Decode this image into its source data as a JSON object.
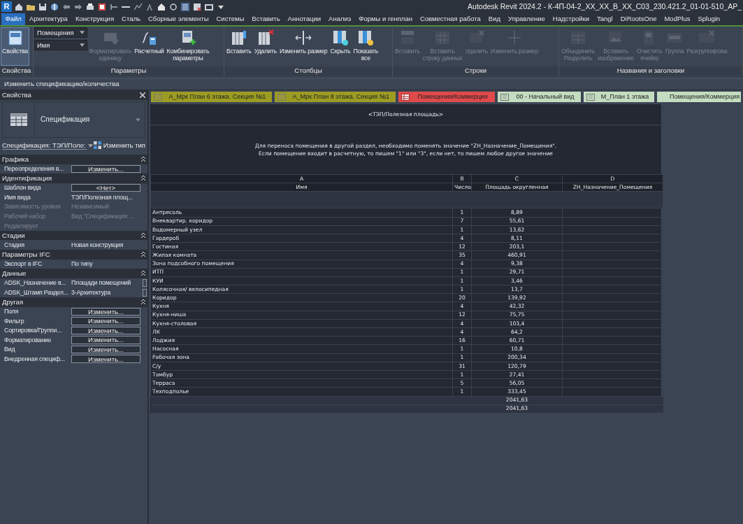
{
  "title_bar": {
    "logo": "R",
    "title": "Autodesk Revit 2024.2 - К-4П-04-2_XX_XX_B_XX_C03_230.421.2_01-01-510_АР_"
  },
  "menu_tabs": [
    {
      "label": "Файл",
      "selected": true
    },
    {
      "label": "Архитектура",
      "selected": false
    },
    {
      "label": "Конструкция",
      "selected": false
    },
    {
      "label": "Сталь",
      "selected": false
    },
    {
      "label": "Сборные элементы",
      "selected": false
    },
    {
      "label": "Системы",
      "selected": false
    },
    {
      "label": "Вставить",
      "selected": false
    },
    {
      "label": "Аннотации",
      "selected": false
    },
    {
      "label": "Анализ",
      "selected": false
    },
    {
      "label": "Формы и генплан",
      "selected": false
    },
    {
      "label": "Совместная работа",
      "selected": false
    },
    {
      "label": "Вид",
      "selected": false
    },
    {
      "label": "Управление",
      "selected": false
    },
    {
      "label": "Надстройки",
      "selected": false
    },
    {
      "label": "Tangl",
      "selected": false
    },
    {
      "label": "DiRootsOne",
      "selected": false
    },
    {
      "label": "ModPlus",
      "selected": false
    },
    {
      "label": "Splugin",
      "selected": false
    }
  ],
  "ribbon": {
    "panels": [
      {
        "label": "Свойства",
        "buttons": [
          {
            "label": "Свойства",
            "on": true,
            "disabled": false
          }
        ]
      },
      {
        "label": "Параметры",
        "combos": [
          {
            "value": "Помещения"
          },
          {
            "value": "Имя"
          }
        ],
        "buttons": [
          {
            "label": "Форматировать\nединицу",
            "on": false,
            "disabled": true
          },
          {
            "label": "Расчетный",
            "on": false,
            "disabled": false
          },
          {
            "label": "Комбинировать\nпараметры",
            "on": false,
            "disabled": false
          }
        ]
      },
      {
        "label": "Столбцы",
        "buttons": [
          {
            "label": "Вставить",
            "on": false,
            "disabled": false
          },
          {
            "label": "Удалить",
            "on": false,
            "disabled": false
          },
          {
            "label": "Изменить размер",
            "on": false,
            "disabled": false
          },
          {
            "label": "Скрыть",
            "on": false,
            "disabled": false
          },
          {
            "label": "Показать\nвсе",
            "on": false,
            "disabled": false
          }
        ]
      },
      {
        "label": "Строки",
        "buttons": [
          {
            "label": "Вставить",
            "on": false,
            "disabled": true
          },
          {
            "label": "Вставить\nстроку данных",
            "on": false,
            "disabled": true
          },
          {
            "label": "Удалить",
            "on": false,
            "disabled": true
          },
          {
            "label": "Изменить размер",
            "on": false,
            "disabled": true
          }
        ]
      },
      {
        "label": "Названия и заголовки",
        "buttons": [
          {
            "label": "Объединить\nРазделить",
            "on": false,
            "disabled": true
          },
          {
            "label": "Вставить\nизображение",
            "on": false,
            "disabled": true
          },
          {
            "label": "Очистить\nячейку",
            "on": false,
            "disabled": true
          },
          {
            "label": "Группа",
            "on": false,
            "disabled": true
          },
          {
            "label": "Разгруппирова",
            "on": false,
            "disabled": true
          }
        ]
      }
    ]
  },
  "context_bar": {
    "text": "Изменить спецификацию/количества"
  },
  "properties": {
    "title": "Свойства",
    "type_name": "Спецификация",
    "selector": "Спецификация: ТЭП/Поле:",
    "edit_type": "Изменить тип",
    "sections": [
      {
        "title": "Графика",
        "expanded": true,
        "rows": [
          {
            "label": "Переопределения в...",
            "value": "Изменить...",
            "kind": "button",
            "disabled": false
          }
        ]
      },
      {
        "title": "Идентификация",
        "expanded": true,
        "rows": [
          {
            "label": "Шаблон вида",
            "value": "<Нет>",
            "kind": "button",
            "disabled": false
          },
          {
            "label": "Имя вида",
            "value": "ТЭП/Полезная площ...",
            "kind": "text",
            "disabled": false
          },
          {
            "label": "Зависимость уровня",
            "value": "Независимый",
            "kind": "text",
            "disabled": true
          },
          {
            "label": "Рабочий набор",
            "value": "Вид \"Спецификация: ...",
            "kind": "text",
            "disabled": true
          },
          {
            "label": "Редактирует",
            "kind": "text",
            "disabled": true
          }
        ]
      },
      {
        "title": "Стадии",
        "expanded": true,
        "rows": [
          {
            "label": "Стадия",
            "value": "Новая конструкция",
            "kind": "text",
            "disabled": false
          }
        ]
      },
      {
        "title": "Параметры IFC",
        "expanded": true,
        "rows": [
          {
            "label": "Экспорт в IFC",
            "value": "По типу",
            "kind": "text",
            "disabled": false
          }
        ]
      },
      {
        "title": "Данные",
        "expanded": true,
        "rows": [
          {
            "label": "ADSK_Назначение в...",
            "value": "Площади помещений",
            "kind": "check",
            "checked": false,
            "disabled": false
          },
          {
            "label": "ADSK_Штамп Раздел...",
            "value": "3-Архитектура",
            "kind": "check",
            "checked": false,
            "disabled": false
          }
        ]
      },
      {
        "title": "Другая",
        "expanded": true,
        "rows": [
          {
            "label": "Поля",
            "value": "Изменить...",
            "kind": "button",
            "disabled": false
          },
          {
            "label": "Фильтр",
            "value": "Изменить...",
            "kind": "button",
            "disabled": false
          },
          {
            "label": "Сортировка/Группи...",
            "value": "Изменить...",
            "kind": "button",
            "disabled": false
          },
          {
            "label": "Форматирование",
            "value": "Изменить...",
            "kind": "button",
            "disabled": false
          },
          {
            "label": "Вид",
            "value": "Изменить...",
            "kind": "button",
            "disabled": false
          },
          {
            "label": "Внедренная специф...",
            "value": "Изменить...",
            "kind": "button",
            "disabled": false
          }
        ]
      }
    ]
  },
  "view_tabs": [
    {
      "label": "А_Мрк План 6 этажа. Секция №1",
      "kind": "sheet",
      "color": "#9c9c24"
    },
    {
      "label": "А_Мрк План 8 этажа. Секция №1",
      "kind": "sheet",
      "color": "#9c9c24"
    },
    {
      "label": "Помещения/Коммерция",
      "kind": "schedule",
      "color": "#e04a4a"
    },
    {
      "label": "00 - Начальный вид",
      "kind": "sheet",
      "color": "#c4dcc0"
    },
    {
      "label": "М_План 1 этажа",
      "kind": "sheet",
      "color": "#c4dcc0"
    },
    {
      "label": "Помещения/Коммерция",
      "kind": "plain",
      "color": "#c4dcc0"
    }
  ],
  "schedule": {
    "title": "<ТЭП/Полезная площадь>",
    "note": "Для переноса помещения в другой раздел, необходимо поменять значение \"ZH_Назначение_Помещения\".\nЕсли помещение входит в расчетную, то пишем \"1\" или \"3\", если нет, то пишем любое другое значение",
    "columns": [
      {
        "letter": "A",
        "name": "Имя"
      },
      {
        "letter": "B",
        "name": "Число"
      },
      {
        "letter": "C",
        "name": "Площадь округленная"
      },
      {
        "letter": "D",
        "name": "ZH_Назначение_Помещения"
      }
    ],
    "rows": [
      {
        "name": "Антресоль",
        "count": "1",
        "area": "8,89"
      },
      {
        "name": "Внеквартир. коридор",
        "count": "7",
        "area": "55,61"
      },
      {
        "name": "Водомерный узел",
        "count": "1",
        "area": "13,62"
      },
      {
        "name": "Гардероб",
        "count": "4",
        "area": "8,11"
      },
      {
        "name": "Гостиная",
        "count": "12",
        "area": "203,1"
      },
      {
        "name": "Жилая комната",
        "count": "35",
        "area": "460,91"
      },
      {
        "name": "Зона подсобного помещения",
        "count": "4",
        "area": "9,38"
      },
      {
        "name": "ИТП",
        "count": "1",
        "area": "29,71"
      },
      {
        "name": "КУИ",
        "count": "1",
        "area": "3,46"
      },
      {
        "name": "Колясочная/ велосипедная",
        "count": "1",
        "area": "13,7"
      },
      {
        "name": "Коридор",
        "count": "20",
        "area": "139,92"
      },
      {
        "name": "Кухня",
        "count": "4",
        "area": "42,32"
      },
      {
        "name": "Кухня-ниша",
        "count": "12",
        "area": "75,75"
      },
      {
        "name": "Кухня-столовая",
        "count": "4",
        "area": "103,4"
      },
      {
        "name": "ЛК",
        "count": "4",
        "area": "64,2"
      },
      {
        "name": "Лоджия",
        "count": "16",
        "area": "60,71"
      },
      {
        "name": "Насосная",
        "count": "1",
        "area": "10,8"
      },
      {
        "name": "Рабочая зона",
        "count": "1",
        "area": "200,34"
      },
      {
        "name": "С/у",
        "count": "31",
        "area": "120,79"
      },
      {
        "name": "Тамбур",
        "count": "1",
        "area": "27,41"
      },
      {
        "name": "Терраса",
        "count": "5",
        "area": "56,05"
      },
      {
        "name": "Техподполье",
        "count": "1",
        "area": "333,45"
      }
    ],
    "totals": [
      "2041,63",
      "2041,63"
    ]
  }
}
